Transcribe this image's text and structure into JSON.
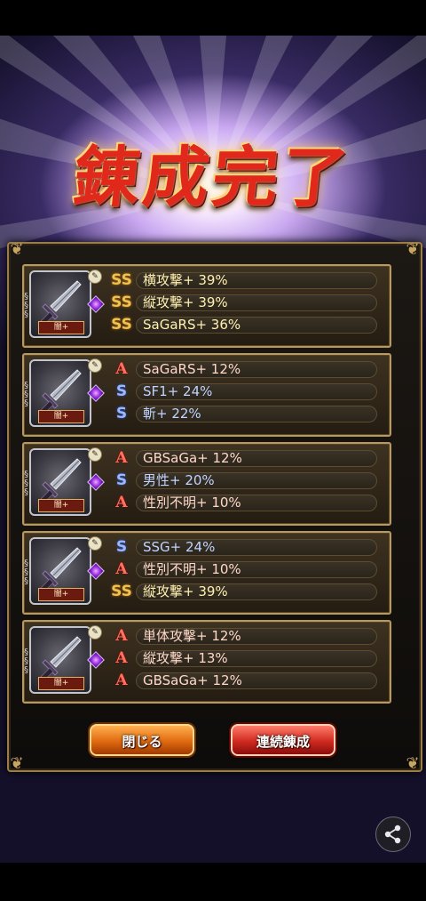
{
  "title": "錬成完了",
  "cards": [
    {
      "weapon_label": "闇+",
      "bonuses": [
        {
          "icon": "gold",
          "text": "横攻撃+ 39%"
        },
        {
          "icon": "gold",
          "text": "縦攻撃+ 39%"
        },
        {
          "icon": "gold",
          "text": "SaGaRS+ 36%"
        }
      ]
    },
    {
      "weapon_label": "闇+",
      "bonuses": [
        {
          "icon": "red",
          "text": "SaGaRS+ 12%"
        },
        {
          "icon": "blue",
          "text": "SF1+ 24%"
        },
        {
          "icon": "blue",
          "text": "斬+ 22%"
        }
      ]
    },
    {
      "weapon_label": "闇+",
      "bonuses": [
        {
          "icon": "red",
          "text": "GBSaGa+ 12%"
        },
        {
          "icon": "blue",
          "text": "男性+ 20%"
        },
        {
          "icon": "red",
          "text": "性別不明+ 10%"
        }
      ]
    },
    {
      "weapon_label": "闇+",
      "bonuses": [
        {
          "icon": "blue",
          "text": "SSG+ 24%"
        },
        {
          "icon": "red",
          "text": "性別不明+ 10%"
        },
        {
          "icon": "gold",
          "text": "縦攻撃+ 39%"
        }
      ]
    },
    {
      "weapon_label": "闇+",
      "bonuses": [
        {
          "icon": "red",
          "text": "単体攻撃+ 12%"
        },
        {
          "icon": "red",
          "text": "縦攻撃+ 13%"
        },
        {
          "icon": "red",
          "text": "GBSaGa+ 12%"
        }
      ]
    }
  ],
  "tier_glyphs": {
    "gold": "SS",
    "red": "A",
    "blue": "S"
  },
  "buttons": {
    "close": "閉じる",
    "again": "連続錬成"
  },
  "colors": {
    "gold_tier": "#f0c050",
    "red_tier": "#ff7060",
    "blue_tier": "#9ab8ff"
  }
}
